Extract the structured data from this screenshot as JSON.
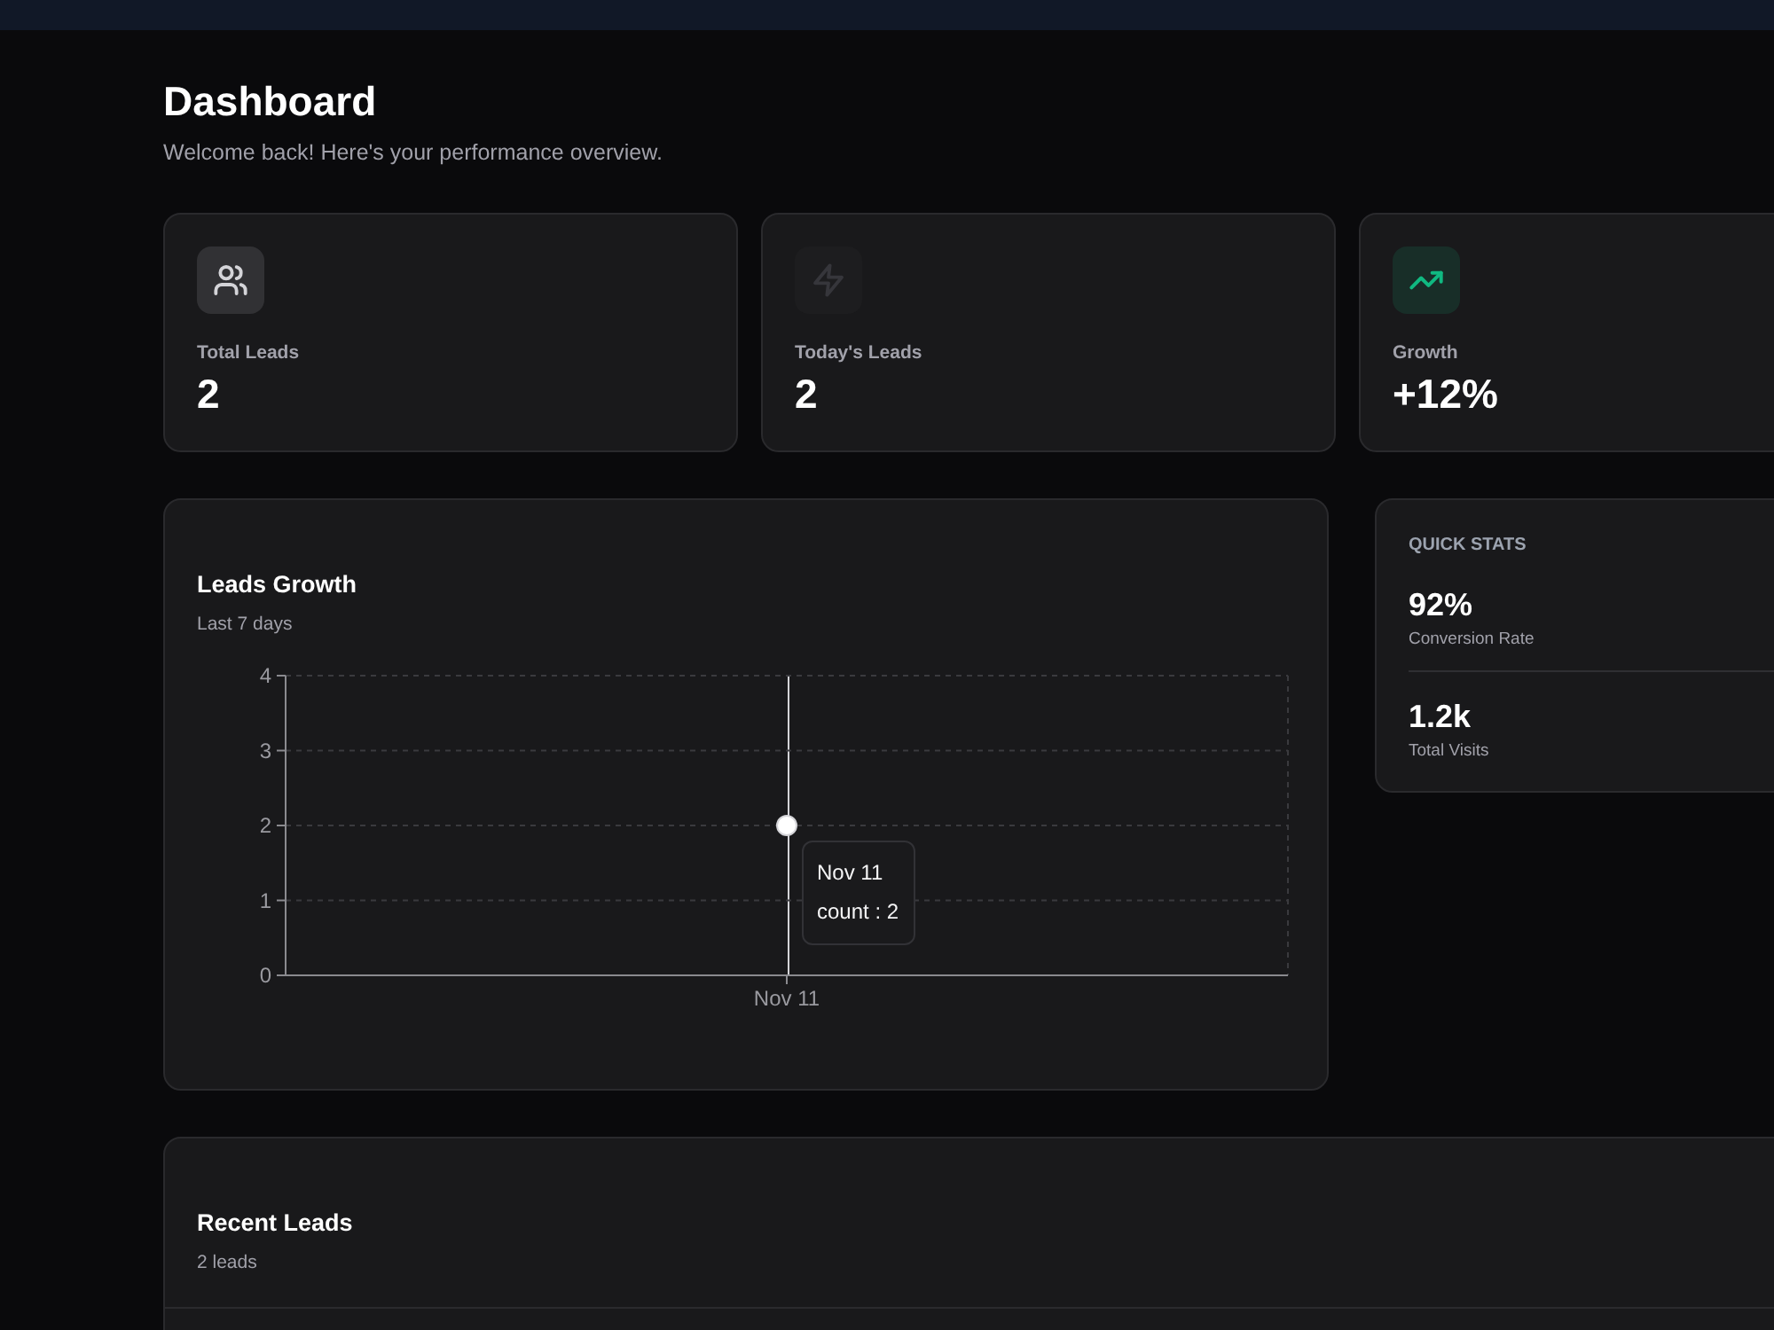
{
  "header": {
    "title": "Dashboard",
    "subtitle": "Welcome back! Here's your performance overview."
  },
  "stat_cards": [
    {
      "label": "Total Leads",
      "value": "2",
      "color": "#d4d4d8"
    },
    {
      "label": "Today's Leads",
      "value": "2",
      "color": "#36363b"
    },
    {
      "label": "Growth",
      "value": "+12%",
      "color": "#10b981"
    }
  ],
  "leads_growth": {
    "title": "Leads Growth",
    "subtitle": "Last 7 days",
    "chart_data": {
      "type": "line",
      "categories": [
        "Nov 11"
      ],
      "series": [
        {
          "name": "count",
          "color": "#ffffff",
          "marker": "circle",
          "values": [
            2
          ]
        }
      ],
      "ylim": [
        0,
        4
      ],
      "yticks": [
        0,
        1,
        2,
        3,
        4
      ],
      "grid": true
    },
    "tooltip": {
      "title": "Nov 11",
      "separator": " : ",
      "value": "2"
    }
  },
  "quick_stats": {
    "title": "QUICK STATS",
    "items": [
      {
        "value": "92%",
        "label": "Conversion Rate"
      },
      {
        "value": "1.2k",
        "label": "Total Visits"
      }
    ]
  },
  "recent_leads": {
    "title": "Recent Leads",
    "subtitle": "2 leads"
  }
}
